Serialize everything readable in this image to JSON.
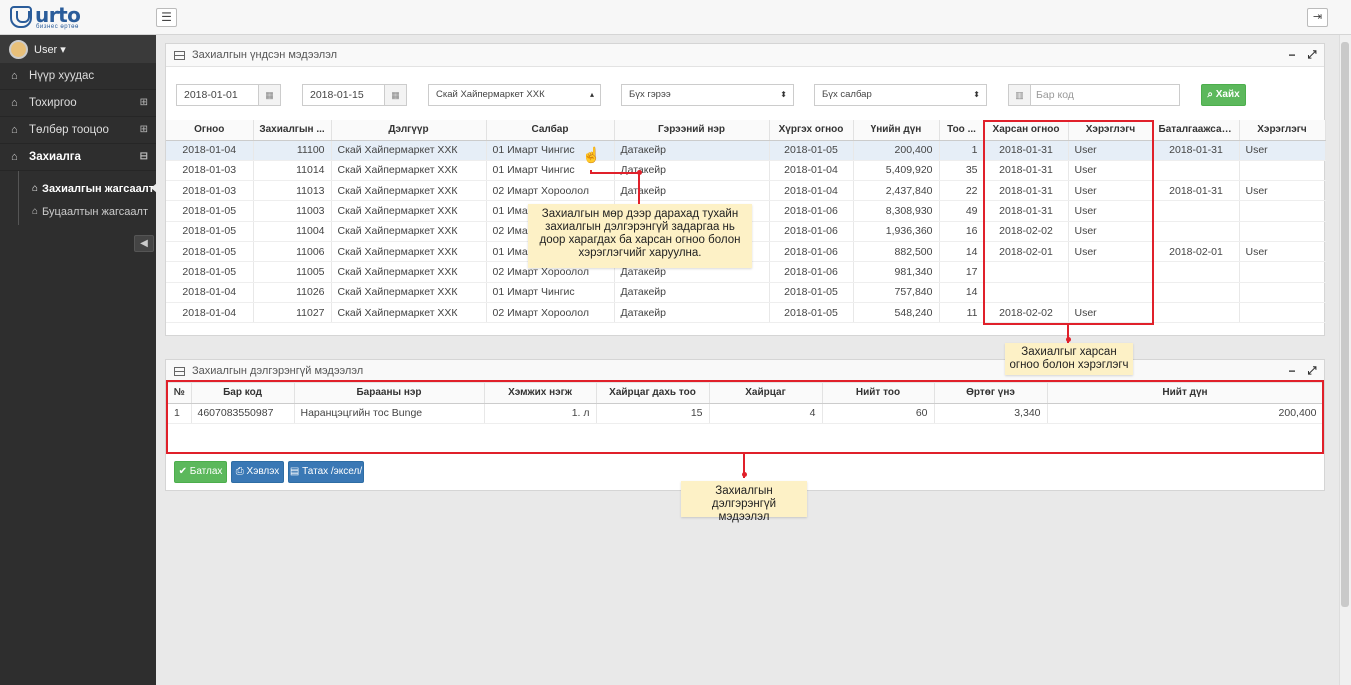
{
  "app": {
    "logo_text": "urto",
    "logo_tagline": "бизнес өртөө",
    "menu_icon": "hamburger-icon",
    "logout_icon": "logout-icon"
  },
  "sidebar": {
    "user": "User ▾",
    "items": [
      {
        "label": "Нүүр хуудас",
        "icon": "home-icon",
        "expandable": false
      },
      {
        "label": "Тохиргоо",
        "icon": "home-icon",
        "expandable": true
      },
      {
        "label": "Төлбөр тооцоо",
        "icon": "home-icon",
        "expandable": true
      },
      {
        "label": "Захиалга",
        "icon": "home-icon",
        "expandable": true
      }
    ],
    "sub_items": [
      {
        "label": "Захиалгын жагсаалт",
        "active": true
      },
      {
        "label": "Буцаалтын жагсаалт",
        "active": false
      }
    ]
  },
  "main_panel": {
    "title": "Захиалгын үндсэн мэдээлэл",
    "filters": {
      "date_from": "2018-01-01",
      "date_to": "2018-01-15",
      "store": "Скай Хайпермаркет ХХК",
      "contract": "Бүх гэрээ",
      "branch": "Бүх салбар",
      "barcode_placeholder": "Бар код",
      "search_label": "Хайх"
    },
    "columns": [
      "Огноо",
      "Захиалгын ...",
      "Дэлгүүр",
      "Салбар",
      "Гэрээний нэр",
      "Хүргэх огноо",
      "Үнийн дүн",
      "Тоо ...",
      "Харсан огноо",
      "Хэрэглэгч",
      "Баталгаажсан...",
      "Хэрэглэгч"
    ],
    "rows": [
      [
        "2018-01-04",
        "11100",
        "Скай Хайпермаркет ХХК",
        "01 Имарт Чингис",
        "Датакейр",
        "2018-01-05",
        "200,400",
        "1",
        "2018-01-31",
        "User",
        "2018-01-31",
        "User"
      ],
      [
        "2018-01-03",
        "11014",
        "Скай Хайпермаркет ХХК",
        "01 Имарт Чингис",
        "Датакейр",
        "2018-01-04",
        "5,409,920",
        "35",
        "2018-01-31",
        "User",
        "",
        ""
      ],
      [
        "2018-01-03",
        "11013",
        "Скай Хайпермаркет ХХК",
        "02 Имарт Хороолол",
        "Датакейр",
        "2018-01-04",
        "2,437,840",
        "22",
        "2018-01-31",
        "User",
        "2018-01-31",
        "User"
      ],
      [
        "2018-01-05",
        "11003",
        "Скай Хайпермаркет ХХК",
        "01 Имар",
        "",
        "2018-01-06",
        "8,308,930",
        "49",
        "2018-01-31",
        "User",
        "",
        ""
      ],
      [
        "2018-01-05",
        "11004",
        "Скай Хайпермаркет ХХК",
        "02 Имар",
        "",
        "2018-01-06",
        "1,936,360",
        "16",
        "2018-02-02",
        "User",
        "",
        ""
      ],
      [
        "2018-01-05",
        "11006",
        "Скай Хайпермаркет ХХК",
        "01 Имар",
        "",
        "2018-01-06",
        "882,500",
        "14",
        "2018-02-01",
        "User",
        "2018-02-01",
        "User"
      ],
      [
        "2018-01-05",
        "11005",
        "Скай Хайпермаркет ХХК",
        "02 Имарт Хороолол",
        "Датакейр",
        "2018-01-06",
        "981,340",
        "17",
        "",
        "",
        "",
        ""
      ],
      [
        "2018-01-04",
        "11026",
        "Скай Хайпермаркет ХХК",
        "01 Имарт Чингис",
        "Датакейр",
        "2018-01-05",
        "757,840",
        "14",
        "",
        "",
        "",
        ""
      ],
      [
        "2018-01-04",
        "11027",
        "Скай Хайпермаркет ХХК",
        "02 Имарт Хороолол",
        "Датакейр",
        "2018-01-05",
        "548,240",
        "11",
        "2018-02-02",
        "User",
        "",
        ""
      ]
    ]
  },
  "detail_panel": {
    "title": "Захиалгын дэлгэрэнгүй мэдээлэл",
    "columns": [
      "№",
      "Бар код",
      "Барааны нэр",
      "Хэмжих нэгж",
      "Хайрцаг дахь тоо",
      "Хайрцаг",
      "Нийт тоо",
      "Өртөг үнэ",
      "Нийт дүн"
    ],
    "rows": [
      [
        "1",
        "4607083550987",
        "Наранцэцгийн тос Bunge",
        "1. л",
        "15",
        "4",
        "60",
        "3,340",
        "200,400"
      ]
    ],
    "buttons": {
      "confirm": "Батлах",
      "print": "Хэвлэх",
      "export": "Татах /эксел/"
    }
  },
  "annotations": {
    "row_click": "Захиалгын мөр дээр дарахад тухайн захиалгын дэлгэрэнгүй задаргаа нь доор харагдах ба харсан огноо болон хэрэглэгчийг харуулна.",
    "viewed": "Захиалгыг харсан огноо болон хэрэглэгч",
    "detail": "Захиалгын дэлгэрэнгүй мэдээлэл"
  },
  "colors": {
    "accent_red": "#e0202a",
    "search_green": "#5cb85c",
    "button_blue": "#3a78b5",
    "sidebar_bg": "#2e2e2e",
    "callout_bg": "#fdf1c6"
  }
}
